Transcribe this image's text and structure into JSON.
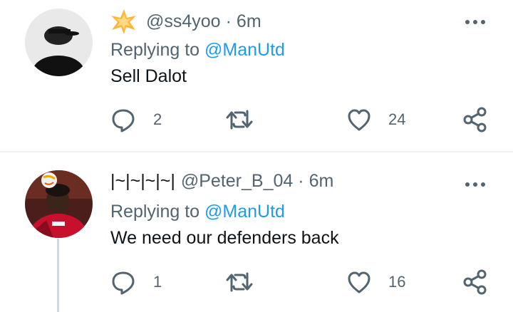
{
  "tweets": [
    {
      "handle": "@ss4yoo",
      "separator": "·",
      "time": "6m",
      "replying_prefix": "Replying to",
      "replying_to": "@ManUtd",
      "text": "Sell Dalot",
      "reply_count": "2",
      "retweet_count": "",
      "like_count": "24",
      "avatar_icon": "hat-silhouette-avatar"
    },
    {
      "name": "|~|~|~|~|",
      "handle": "@Peter_B_04",
      "separator": "·",
      "time": "6m",
      "replying_prefix": "Replying to",
      "replying_to": "@ManUtd",
      "text": "We need our defenders back",
      "reply_count": "1",
      "retweet_count": "",
      "like_count": "16",
      "avatar_icon": "football-player-avatar"
    }
  ],
  "colors": {
    "secondary_text": "#536471",
    "primary_text": "#0f1419",
    "accent": "#1d9bf0",
    "divider": "#eff3f4"
  }
}
